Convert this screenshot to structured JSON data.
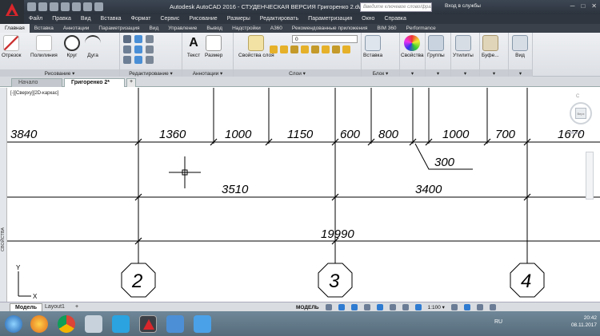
{
  "window": {
    "title": "Autodesk AutoCAD 2016 - СТУДЕНЧЕСКАЯ ВЕРСИЯ     Григоренко 2.dwg",
    "search_placeholder": "Введите ключевое слово/фразу",
    "signin": "Вход в службы",
    "win_buttons": [
      "─",
      "□",
      "✕"
    ]
  },
  "menu": [
    "Файл",
    "Правка",
    "Вид",
    "Вставка",
    "Формат",
    "Сервис",
    "Рисование",
    "Размеры",
    "Редактировать",
    "Параметризация",
    "Окно",
    "Справка"
  ],
  "ribbon_tabs": [
    "Главная",
    "Вставка",
    "Аннотации",
    "Параметризация",
    "Вид",
    "Управление",
    "Вывод",
    "Надстройки",
    "A360",
    "Рекомендованные приложения",
    "BIM 360",
    "Performance"
  ],
  "ribbon": {
    "draw": {
      "label": "Рисование ▾",
      "tools": [
        "Отрезок",
        "Полилиния",
        "Круг",
        "Дуга"
      ]
    },
    "modify": {
      "label": "Редактирование ▾"
    },
    "annotation": {
      "label": "Аннотации ▾",
      "tools": [
        "Текст",
        "Размер"
      ]
    },
    "layers": {
      "label": "Слои ▾",
      "tool": "Свойства слоя",
      "current_layer": "0"
    },
    "block": {
      "label": "Блок ▾",
      "tool": "Вставка"
    },
    "properties": {
      "tool": "Свойства"
    },
    "groups": {
      "tool": "Группы"
    },
    "utilities": {
      "tool": "Утилиты"
    },
    "clipboard": {
      "tool": "Буфе..."
    },
    "view": {
      "tool": "Вид"
    }
  },
  "doc_tabs": {
    "start": "Начало",
    "drawing": "Григоренко 2*",
    "add": "+"
  },
  "viewport": {
    "control": "[-][Сверху][2D-каркас]",
    "viewcube_top": "C",
    "viewcube_face": "Верх",
    "wcs": "МСК ▾",
    "palette_label": "СВОЙСТВА"
  },
  "drawing": {
    "dim_row1": [
      "3840",
      "1360",
      "1000",
      "1150",
      "600",
      "800",
      "1000",
      "700",
      "1670"
    ],
    "leader_dim": "300",
    "dim_row2": [
      "3510",
      "3400"
    ],
    "total_dim": "19990",
    "axes": [
      "2",
      "3",
      "4"
    ],
    "ucs_x": "X",
    "ucs_y": "Y"
  },
  "layout_tabs": {
    "model": "Модель",
    "layout1": "Layout1",
    "add": "+"
  },
  "status": {
    "mode": "МОДЕЛЬ",
    "scale": "1:100 ▾"
  },
  "taskbar": {
    "lang": "RU",
    "time": "20:42",
    "date": "08.11.2017"
  }
}
